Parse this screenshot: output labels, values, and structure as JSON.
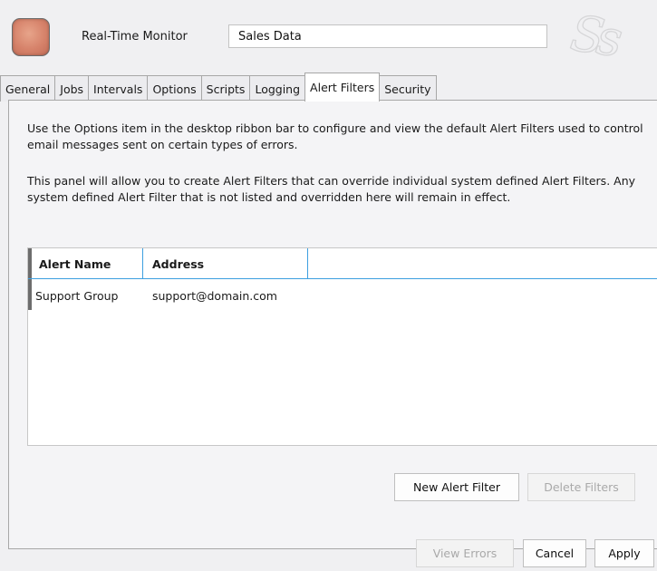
{
  "header": {
    "monitor_label": "Real-Time Monitor",
    "name_value": "Sales Data",
    "watermark": "Ss"
  },
  "tabs": [
    {
      "label": "General"
    },
    {
      "label": "Jobs"
    },
    {
      "label": "Intervals"
    },
    {
      "label": "Options"
    },
    {
      "label": "Scripts"
    },
    {
      "label": "Logging"
    },
    {
      "label": "Alert Filters",
      "active": true
    },
    {
      "label": "Security"
    }
  ],
  "panel": {
    "paragraph1": "Use the Options item in the desktop ribbon bar to configure and view the default Alert Filters used to control email messages sent on certain types of errors.",
    "paragraph2": "This panel will allow you to create Alert Filters that can override individual system defined Alert Filters. Any system defined Alert Filter that is not listed and overridden here will remain in effect.",
    "grid": {
      "columns": [
        "Alert Name",
        "Address"
      ],
      "rows": [
        {
          "alert_name": "Support Group",
          "address": "support@domain.com"
        }
      ]
    },
    "new_filter_label": "New Alert Filter",
    "delete_filters_label": "Delete Filters"
  },
  "footer": {
    "view_errors_label": "View Errors",
    "cancel_label": "Cancel",
    "apply_label": "Apply"
  }
}
